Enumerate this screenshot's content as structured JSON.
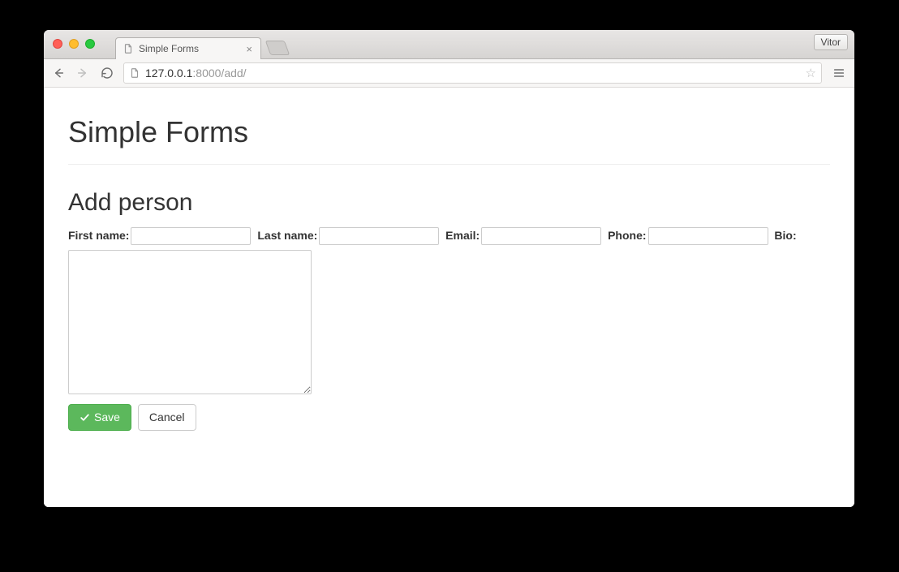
{
  "browser": {
    "tab_title": "Simple Forms",
    "user_badge": "Vitor",
    "url_host": "127.0.0.1",
    "url_rest": ":8000/add/"
  },
  "page": {
    "title": "Simple Forms",
    "section_title": "Add person"
  },
  "form": {
    "fields": {
      "first_name": {
        "label": "First name:",
        "value": ""
      },
      "last_name": {
        "label": "Last name:",
        "value": ""
      },
      "email": {
        "label": "Email:",
        "value": ""
      },
      "phone": {
        "label": "Phone:",
        "value": ""
      },
      "bio": {
        "label": "Bio:",
        "value": ""
      }
    },
    "buttons": {
      "save": "Save",
      "cancel": "Cancel"
    }
  }
}
